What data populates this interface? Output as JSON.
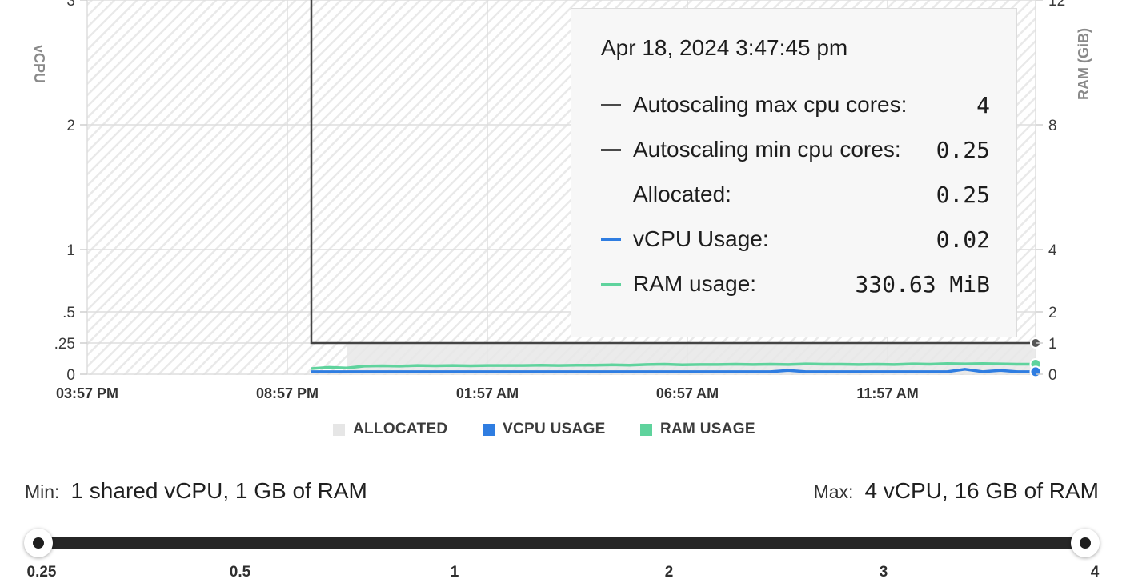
{
  "chart_data": {
    "type": "line",
    "left_axis": {
      "label": "vCPU",
      "ticks": [
        "0",
        ".25",
        ".5",
        "1",
        "2",
        "3"
      ],
      "values": [
        0,
        0.25,
        0.5,
        1,
        2,
        3
      ]
    },
    "right_axis": {
      "label": "RAM (GiB)",
      "ticks": [
        "0",
        "1",
        "2",
        "4",
        "8",
        "12"
      ],
      "values": [
        0,
        1,
        2,
        4,
        8,
        12
      ]
    },
    "x_ticks": [
      "03:57 PM",
      "08:57 PM",
      "01:57 AM",
      "06:57 AM",
      "11:57 AM"
    ],
    "x_range_hours": [
      0,
      23.7
    ],
    "series": [
      {
        "name": "Autoscaling max cpu cores",
        "color": "#444444",
        "value": 4
      },
      {
        "name": "Autoscaling min cpu cores",
        "color": "#444444",
        "value": 0.25
      },
      {
        "name": "Allocated",
        "color": "#e6e6e6",
        "value": 0.25,
        "start_hour": 6.5
      },
      {
        "name": "vCPU Usage",
        "color": "#2f7de1",
        "start_hour": 5.6,
        "values": [
          0.02,
          0.02,
          0.02,
          0.02,
          0.02,
          0.02,
          0.02,
          0.02,
          0.02,
          0.02,
          0.02,
          0.02,
          0.02,
          0.02,
          0.02,
          0.02,
          0.02,
          0.02,
          0.02,
          0.02,
          0.02,
          0.02,
          0.02,
          0.02,
          0.02,
          0.02,
          0.02,
          0.03,
          0.02,
          0.02,
          0.02,
          0.02,
          0.02,
          0.02,
          0.02,
          0.02,
          0.02,
          0.04,
          0.02,
          0.03,
          0.02,
          0.02
        ]
      },
      {
        "name": "RAM usage",
        "color": "#5fd39d",
        "start_hour": 5.6,
        "values_gib": [
          0.18,
          0.22,
          0.2,
          0.26,
          0.27,
          0.26,
          0.28,
          0.27,
          0.28,
          0.27,
          0.28,
          0.28,
          0.28,
          0.29,
          0.28,
          0.29,
          0.29,
          0.3,
          0.29,
          0.31,
          0.32,
          0.3,
          0.31,
          0.31,
          0.32,
          0.31,
          0.32,
          0.31,
          0.33,
          0.32,
          0.32,
          0.31,
          0.32,
          0.31,
          0.33,
          0.32,
          0.34,
          0.33,
          0.34,
          0.33,
          0.32,
          0.32
        ]
      }
    ],
    "legend": [
      {
        "label": "ALLOCATED",
        "color": "#e6e6e6"
      },
      {
        "label": "VCPU USAGE",
        "color": "#2f7de1"
      },
      {
        "label": "RAM USAGE",
        "color": "#5fd39d"
      }
    ],
    "grid": true,
    "legend_position": "bottom"
  },
  "tooltip": {
    "title": "Apr 18, 2024 3:47:45 pm",
    "rows": [
      {
        "label": "Autoscaling max cpu cores:",
        "value": "4",
        "color": "#4a4a4a"
      },
      {
        "label": "Autoscaling min cpu cores:",
        "value": "0.25",
        "color": "#4a4a4a"
      },
      {
        "label": "Allocated:",
        "value": "0.25",
        "color": "transparent"
      },
      {
        "label": "vCPU Usage:",
        "value": "0.02",
        "color": "#2f7de1"
      },
      {
        "label": "RAM usage:",
        "value": "330.63 MiB",
        "color": "#5fd39d"
      }
    ]
  },
  "limits": {
    "min_label": "Min:",
    "min_value": "1 shared vCPU, 1 GB of RAM",
    "max_label": "Max:",
    "max_value": "4 vCPU, 16 GB of RAM"
  },
  "slider": {
    "ticks": [
      "0.25",
      "0.5",
      "1",
      "2",
      "3",
      "4"
    ],
    "min": "0.25",
    "max": "4"
  }
}
